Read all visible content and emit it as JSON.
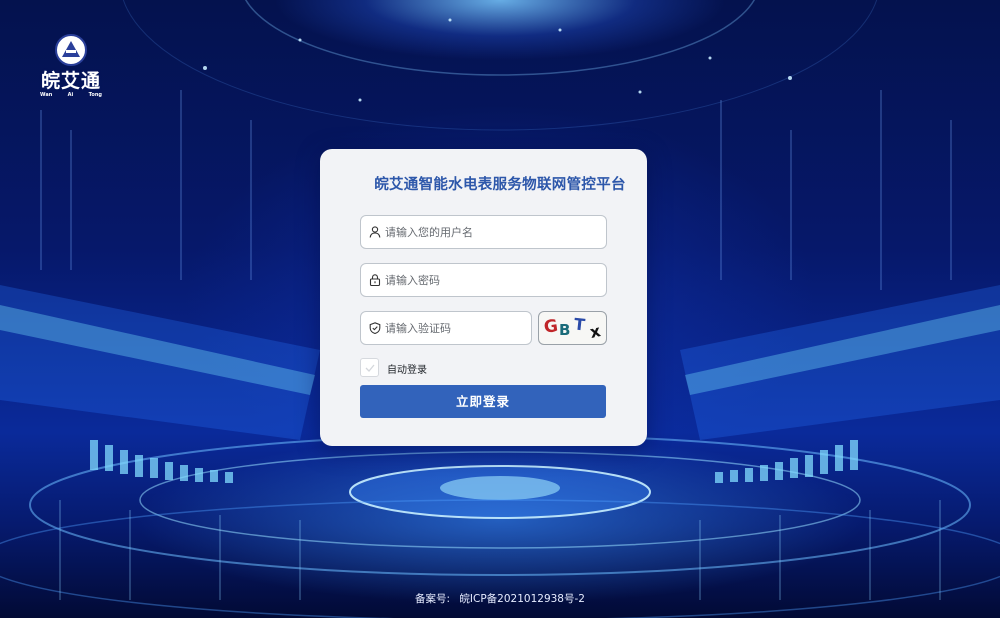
{
  "brand": {
    "logo_text": "皖艾通",
    "logo_sub": [
      "Wan",
      "Ai",
      "Tong"
    ]
  },
  "login": {
    "title": "皖艾通智能水电表服务物联网管控平台",
    "username_placeholder": "请输入您的用户名",
    "password_placeholder": "请输入密码",
    "captcha_placeholder": "请输入验证码",
    "captcha_chars": [
      "G",
      "B",
      "T",
      "x"
    ],
    "remember_label": "自动登录",
    "submit_label": "立即登录"
  },
  "footer": {
    "icp_label": "备案号:",
    "icp_number": "皖ICP备2021012938号-2"
  },
  "colors": {
    "accent": "#3263bb",
    "title": "#2d57aa",
    "background": "#050f4a"
  },
  "icons": [
    "user-icon",
    "lock-icon",
    "shield-check-icon",
    "check-icon"
  ]
}
